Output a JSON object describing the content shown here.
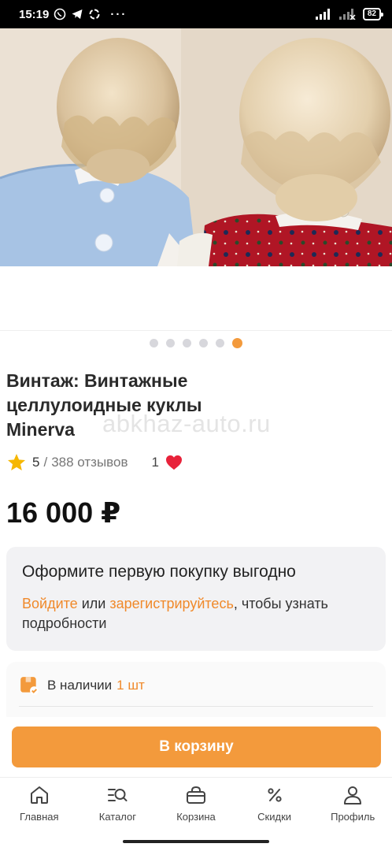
{
  "status_bar": {
    "time": "15:19",
    "dots": "···",
    "battery": "82"
  },
  "product": {
    "gallery": {
      "count": 6,
      "active_index": 5
    },
    "title": "Винтаж: Винтажные целлулоидные куклы Minerva",
    "watermark": "abkhaz-auto.ru",
    "rating": {
      "value": "5",
      "separator": "/",
      "reviews": "388 отзывов"
    },
    "favorites_count": "1",
    "price": "16 000 ₽"
  },
  "promo": {
    "title": "Оформите первую покупку выгодно",
    "login_link": "Войдите",
    "or": " или ",
    "register_link": "зарегистрируйтесь",
    "tail": ", чтобы узнать подробности"
  },
  "stock": {
    "label": "В наличии",
    "quantity": "1 шт"
  },
  "cart_button": {
    "label": "В корзину"
  },
  "bottom_nav": {
    "items": [
      {
        "label": "Главная",
        "icon": "home-icon"
      },
      {
        "label": "Каталог",
        "icon": "catalog-search-icon"
      },
      {
        "label": "Корзина",
        "icon": "bag-icon"
      },
      {
        "label": "Скидки",
        "icon": "percent-icon"
      },
      {
        "label": "Профиль",
        "icon": "user-icon"
      }
    ]
  },
  "colors": {
    "accent": "#f39a3c",
    "link": "#f0892a",
    "heart": "#e8223a",
    "star": "#f6b700"
  }
}
